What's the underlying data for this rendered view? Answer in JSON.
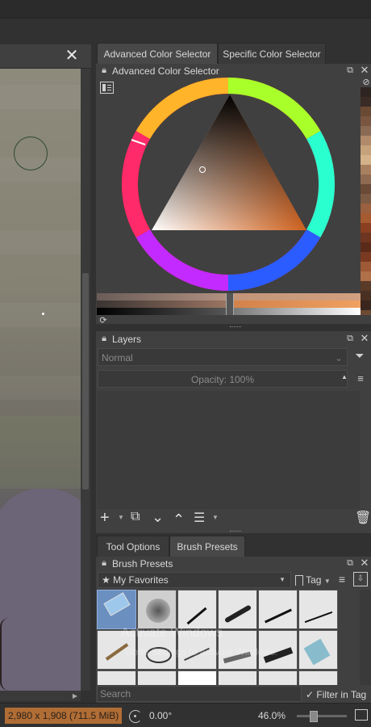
{
  "tabs": {
    "advanced": "Advanced Color Selector",
    "specific": "Specific Color Selector"
  },
  "color_selector": {
    "title": "Advanced Color Selector",
    "current_color": "#c86a2a",
    "history_colors": [
      "#2f2520",
      "#3a2c24",
      "#6b4a34",
      "#7a5640",
      "#8a6a55",
      "#b08a6a",
      "#c6a27a",
      "#d4b28a",
      "#a88060",
      "#8e6a50",
      "#6a4a36",
      "#7d5a44",
      "#9a6040",
      "#a65a30",
      "#8a4020",
      "#6e3520",
      "#5c2a18",
      "#7a3a22",
      "#9e5a36",
      "#b07048",
      "#5a3a28",
      "#4a3022",
      "#3a261c"
    ]
  },
  "layers": {
    "title": "Layers",
    "blend_mode": "Normal",
    "opacity_label": "Opacity:  100%"
  },
  "bottom_tabs": {
    "tool_options": "Tool Options",
    "brush_presets": "Brush Presets"
  },
  "brush_presets": {
    "title": "Brush Presets",
    "favorites": "My Favorites",
    "tag_label": "Tag",
    "search_placeholder": "Search",
    "filter_label": "Filter in Tag"
  },
  "watermark": {
    "line1": "Activate Windows",
    "line2": "Go to Settings to activate Windows."
  },
  "status_bar": {
    "dimensions": "2,980 x 1,908 (711.5 MiB)",
    "rotation": "0.00°",
    "zoom": "46.0%"
  },
  "icons": {
    "close": "close-icon",
    "float": "float-icon",
    "lock": "lock-icon"
  }
}
